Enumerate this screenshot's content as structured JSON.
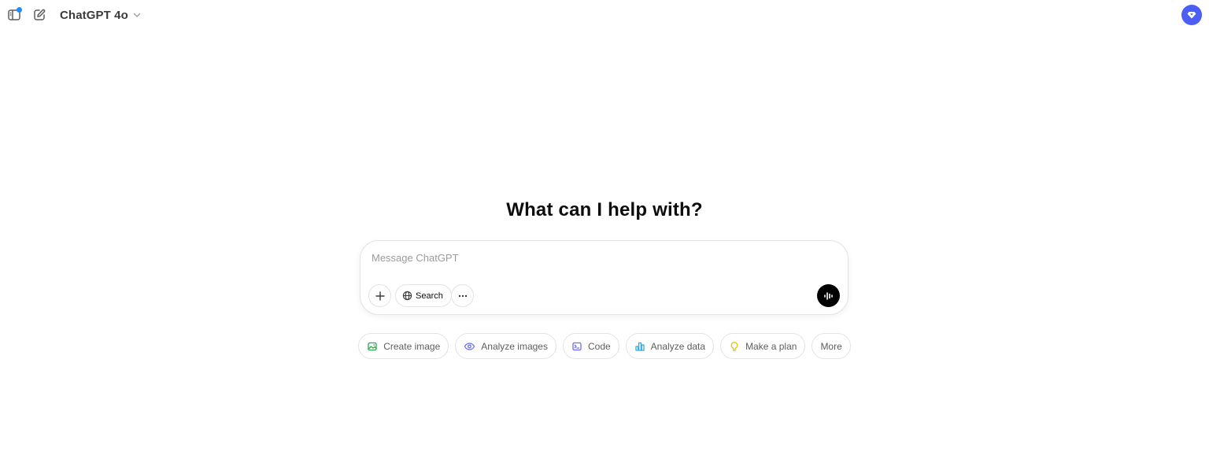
{
  "header": {
    "model_name": "ChatGPT 4o",
    "icons": {
      "sidebar": "sidebar-toggle-icon",
      "new_chat": "new-chat-icon",
      "model_dropdown": "chevron-down-icon",
      "upgrade": "upgrade-icon"
    },
    "notification_color": "#1f8cff",
    "upgrade_color": "#4d5ef5"
  },
  "main": {
    "headline": "What can I help with?"
  },
  "composer": {
    "placeholder": "Message ChatGPT",
    "value": "",
    "search_label": "Search",
    "icons": {
      "attach": "plus-icon",
      "search": "globe-icon",
      "more": "ellipsis-icon",
      "voice": "voice-wave-icon"
    }
  },
  "suggestions": [
    {
      "label": "Create image",
      "icon": "image-icon",
      "color": "#2ea84a"
    },
    {
      "label": "Analyze images",
      "icon": "eye-icon",
      "color": "#6b6ef0"
    },
    {
      "label": "Code",
      "icon": "code-terminal-icon",
      "color": "#6b6ef0"
    },
    {
      "label": "Analyze data",
      "icon": "bar-chart-icon",
      "color": "#35a8e0"
    },
    {
      "label": "Make a plan",
      "icon": "lightbulb-icon",
      "color": "#e8c410"
    },
    {
      "label": "More",
      "icon": "",
      "color": "#5d5d5d"
    }
  ]
}
